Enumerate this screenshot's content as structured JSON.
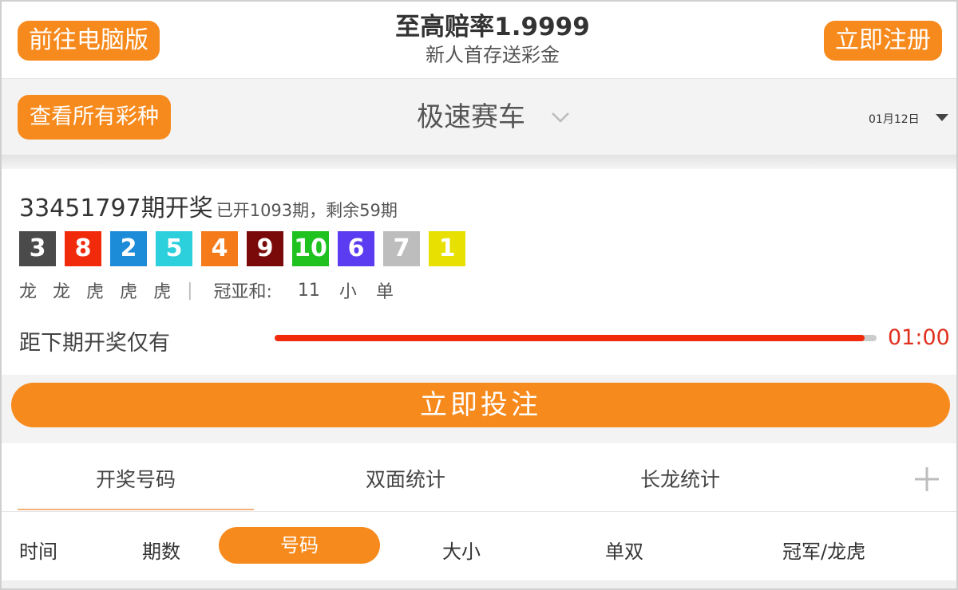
{
  "header": {
    "pc_button": "前往电脑版",
    "register_button": "立即注册",
    "promo_title": "至高赔率1.9999",
    "promo_subtitle": "新人首存送彩金"
  },
  "selector": {
    "all_games_button": "查看所有彩种",
    "game_name": "极速赛车",
    "date": "01月12日"
  },
  "result": {
    "issue_title": "33451797期开奖",
    "issue_info": "已开1093期，剩余59期",
    "balls": [
      {
        "num": "3",
        "color": "#4a4a4a"
      },
      {
        "num": "8",
        "color": "#f22a0c"
      },
      {
        "num": "2",
        "color": "#1c8bd8"
      },
      {
        "num": "5",
        "color": "#2bd0dc"
      },
      {
        "num": "4",
        "color": "#f57a1a"
      },
      {
        "num": "9",
        "color": "#7a0a0a"
      },
      {
        "num": "10",
        "color": "#1fc21f"
      },
      {
        "num": "6",
        "color": "#5b3cf0"
      },
      {
        "num": "7",
        "color": "#bdbdbd"
      },
      {
        "num": "1",
        "color": "#e8e000"
      }
    ],
    "dragon_tiger": [
      "龙",
      "龙",
      "虎",
      "虎",
      "虎"
    ],
    "separator": "|",
    "sum_label": "冠亚和:",
    "sum_value": "11",
    "sum_size": "小",
    "sum_parity": "单",
    "countdown_label": "距下期开奖仅有",
    "countdown_time": "01:00",
    "countdown_progress": 0.98
  },
  "bet_button": "立即投注",
  "tabs": [
    "开奖号码",
    "双面统计",
    "长龙统计"
  ],
  "active_tab": 0,
  "filters": {
    "time": "时间",
    "issue": "期数",
    "number": "号码",
    "size": "大小",
    "parity": "单双",
    "champion": "冠军/龙虎"
  },
  "colors": {
    "accent": "#f78a1d",
    "countdown": "#e0301e",
    "progress": "#f22a0c"
  }
}
